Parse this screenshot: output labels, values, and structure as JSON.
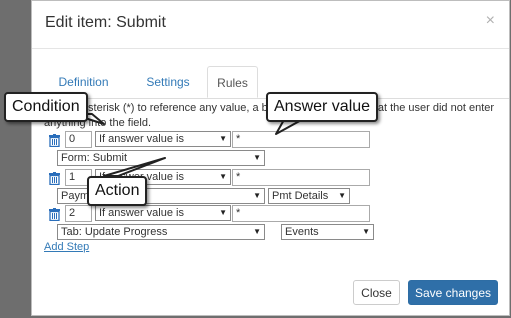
{
  "modal": {
    "title": "Edit item: Submit",
    "close_glyph": "×",
    "tabs": [
      {
        "label": "Definition",
        "active": false
      },
      {
        "label": "Settings",
        "active": false
      },
      {
        "label": "Rules",
        "active": true
      }
    ],
    "help_text": "Use an asterisk (*) to reference any value, a blank value for a field that the user did not enter anything into the field.",
    "steps": [
      {
        "number": "0",
        "condition": "If answer value is",
        "answer": "*",
        "action": "Form: Submit",
        "extra": ""
      },
      {
        "number": "1",
        "condition": "If answer value is",
        "answer": "*",
        "action": "Payment Profile",
        "extra": "Pmt Details"
      },
      {
        "number": "2",
        "condition": "If answer value is",
        "answer": "*",
        "action": "Tab: Update Progress",
        "extra": "Events"
      }
    ],
    "add_step_label": "Add Step",
    "close_button_label": "Close",
    "save_button_label": "Save changes"
  },
  "callouts": {
    "condition": "Condition",
    "answer_value": "Answer value",
    "action": "Action"
  },
  "icons": {
    "delete": "trash-icon",
    "dropdown": "chevron-down-icon"
  },
  "colors": {
    "link": "#337ab7",
    "primary_button": "#2f6fa8",
    "trash": "#2a6ebb",
    "backdrop": "#6e6e6e"
  }
}
